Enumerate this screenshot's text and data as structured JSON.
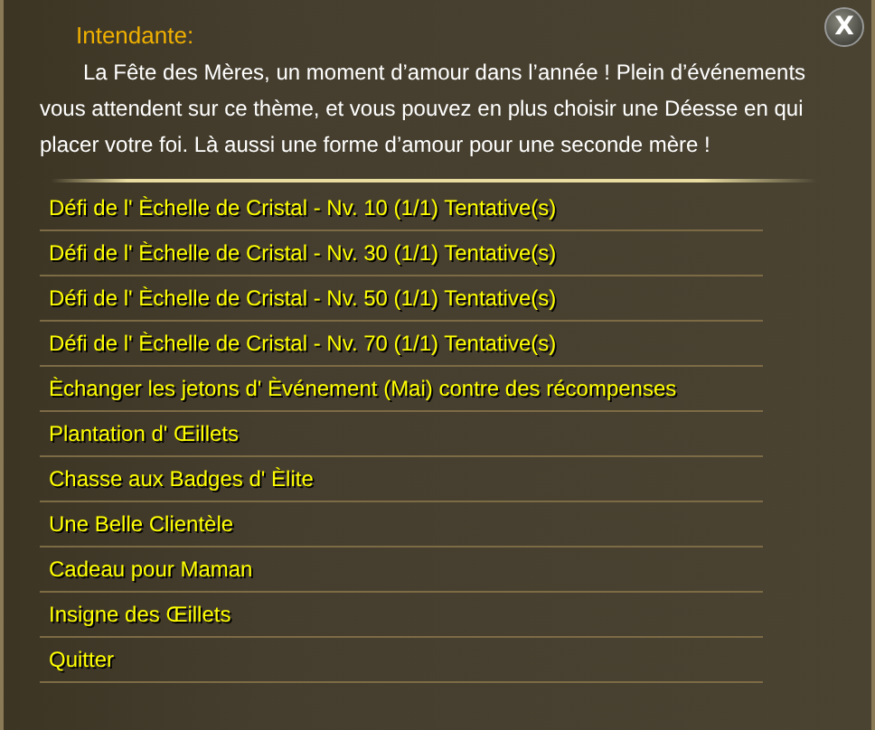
{
  "dialog": {
    "speaker": "Intendante:",
    "message": "La Fête des Mères, un moment d’amour dans l’année ! Plein d’événements vous attendent sur ce thème, et vous pouvez en plus choisir une Déesse en qui placer votre foi. Là aussi une forme d’amour pour une seconde mère !",
    "close": "X"
  },
  "options": [
    {
      "label": "Défi de l' Èchelle de Cristal - Nv. 10 (1/1) Tentative(s)"
    },
    {
      "label": "Défi de l' Èchelle de Cristal - Nv. 30 (1/1) Tentative(s)"
    },
    {
      "label": "Défi de l' Èchelle de Cristal - Nv. 50 (1/1) Tentative(s)"
    },
    {
      "label": "Défi de l' Èchelle de Cristal - Nv. 70 (1/1) Tentative(s)"
    },
    {
      "label": "Èchanger les jetons d' Èvénement (Mai) contre des récompenses"
    },
    {
      "label": "Plantation d' Œillets"
    },
    {
      "label": "Chasse aux Badges d' Èlite"
    },
    {
      "label": "Une Belle Clientèle"
    },
    {
      "label": "Cadeau pour Maman"
    },
    {
      "label": "Insigne des Œillets"
    },
    {
      "label": "Quitter"
    }
  ]
}
